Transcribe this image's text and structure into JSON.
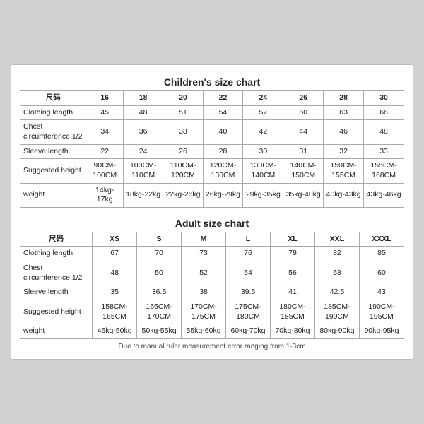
{
  "children_title": "Children's size chart",
  "adult_title": "Adult size chart",
  "footer_note": "Due to manual ruler measurement error ranging from 1-3cm",
  "children": {
    "headers": [
      "尺码",
      "16",
      "18",
      "20",
      "22",
      "24",
      "26",
      "28",
      "30"
    ],
    "rows": [
      {
        "label": "Clothing length",
        "values": [
          "45",
          "48",
          "51",
          "54",
          "57",
          "60",
          "63",
          "66"
        ]
      },
      {
        "label": "Chest circumference 1/2",
        "values": [
          "34",
          "36",
          "38",
          "40",
          "42",
          "44",
          "46",
          "48"
        ]
      },
      {
        "label": "Sleeve length",
        "values": [
          "22",
          "24",
          "26",
          "28",
          "30",
          "31",
          "32",
          "33"
        ]
      },
      {
        "label": "Suggested height",
        "values": [
          "90CM-100CM",
          "100CM-110CM",
          "110CM-120CM",
          "120CM-130CM",
          "130CM-140CM",
          "140CM-150CM",
          "150CM-155CM",
          "155CM-168CM"
        ]
      },
      {
        "label": "weight",
        "values": [
          "14kg-17kg",
          "18kg-22kg",
          "22kg-26kg",
          "26kg-29kg",
          "29kg-35kg",
          "35kg-40kg",
          "40kg-43kg",
          "43kg-46kg"
        ]
      }
    ]
  },
  "adult": {
    "headers": [
      "尺码",
      "XS",
      "S",
      "M",
      "L",
      "XL",
      "XXL",
      "XXXL"
    ],
    "rows": [
      {
        "label": "Clothing length",
        "values": [
          "67",
          "70",
          "73",
          "76",
          "79",
          "82",
          "85"
        ]
      },
      {
        "label": "Chest circumference 1/2",
        "values": [
          "48",
          "50",
          "52",
          "54",
          "56",
          "58",
          "60"
        ]
      },
      {
        "label": "Sleeve length",
        "values": [
          "35",
          "36.5",
          "38",
          "39.5",
          "41",
          "42.5",
          "43"
        ]
      },
      {
        "label": "Suggested height",
        "values": [
          "158CM-165CM",
          "165CM-170CM",
          "170CM-175CM",
          "175CM-180CM",
          "180CM-185CM",
          "185CM-190CM",
          "190CM-195CM"
        ]
      },
      {
        "label": "weight",
        "values": [
          "46kg-50kg",
          "50kg-55kg",
          "55kg-60kg",
          "60kg-70kg",
          "70kg-80kg",
          "80kg-90kg",
          "90kg-95kg"
        ]
      }
    ]
  }
}
